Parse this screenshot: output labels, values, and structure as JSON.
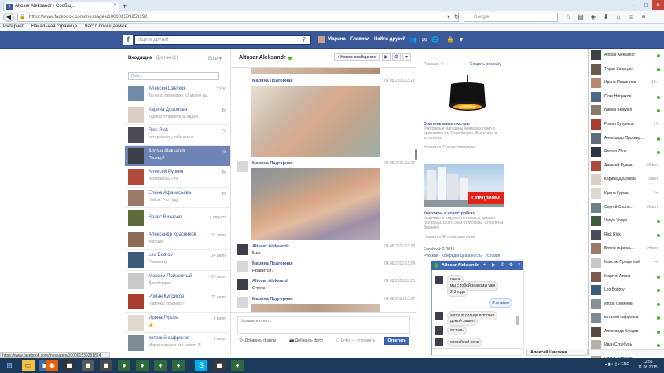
{
  "browser": {
    "tab_title": "Altosar Aleksandr - Сообщ...",
    "tab_close": "×",
    "new_tab": "+",
    "url": "https://www.facebook.com/messages/100001539259192",
    "search_placeholder": "Google",
    "bookmarks": [
      "Интернет",
      "Начальная страница",
      "Часто посещаемые"
    ],
    "status_url": "https://www.facebook.com/messages/100001539291824"
  },
  "fb": {
    "logo": "f",
    "search_placeholder": "Ищите друзей",
    "profile_name": "Марина",
    "home": "Главная",
    "find_friends": "Найти друзей"
  },
  "inbox": {
    "tab_inbox": "Входящие",
    "tab_other": "Другое (1)",
    "more": "Еще ▾",
    "search_placeholder": "Поиск",
    "conversations": [
      {
        "name": "Алексей Цветков",
        "snippet": "Ты но хз перевозку (c) может вы...",
        "time": "12:30",
        "avatar": "#6f8ba8"
      },
      {
        "name": "Карина Доцонова",
        "snippet": "Карина отправил(-а) видео.",
        "time": "Вт",
        "avatar": "#d9cfc4"
      },
      {
        "name": "Rick Rick",
        "snippet": "интересная у тебя жизнь",
        "time": "Пт",
        "avatar": "#4a4d58"
      },
      {
        "name": "Altosar Aleksandr",
        "snippet": "Почему?",
        "time": "Чт",
        "avatar": "#3a3f4a"
      },
      {
        "name": "Алексей Ручкин",
        "snippet": "Вспомнишь 7-го",
        "time": "Вт",
        "avatar": "#b04a3a"
      },
      {
        "name": "Елена Афанасьева",
        "snippet": "Найси. 7-го буд)",
        "time": "Вт",
        "avatar": "#9a7b67"
      },
      {
        "name": "Велес Вихарев",
        "snippet": "",
        "time": "4 августа",
        "avatar": "#5d6b3a"
      },
      {
        "name": "Александр Красников",
        "snippet": "Хорошо",
        "time": "31 июля",
        "avatar": "#8c6b52"
      },
      {
        "name": "Leo Bodrov",
        "snippet": "Приветик)",
        "time": "24 июля",
        "avatar": "#3d5a7a"
      },
      {
        "name": "Максим Прицепный",
        "snippet": "Докой пора!",
        "time": "23 июля",
        "avatar": "#c8c8c8"
      },
      {
        "name": "Роман Куприков",
        "snippet": "Рамочка, спасибо!!!",
        "time": "23 июля",
        "avatar": "#a63c2e"
      },
      {
        "name": "Ирина Гурова",
        "snippet": "👍",
        "time": "9 июля",
        "avatar": "#e0d8ce"
      },
      {
        "name": "виталий сафронов",
        "snippet": "Марина привет что нового !!!",
        "time": "2 июля",
        "avatar": "#7d8a96"
      }
    ]
  },
  "thread": {
    "name": "Altosar Aleksandr",
    "new_message": "+ Новое сообщение",
    "messages": [
      {
        "name": "Марина Подгорная",
        "time": "04.08.2015 13:22",
        "text": ""
      },
      {
        "name": "Марина Подгорная",
        "time": "04.08.2015 13:22",
        "text": ""
      },
      {
        "name": "Altosar Aleksandr",
        "time": "04.08.2015 13:23",
        "text": "Мне"
      },
      {
        "name": "Марина Подгорная",
        "time": "04.08.2015 13:24",
        "text": "Нравится?"
      },
      {
        "name": "Altosar Aleksandr",
        "time": "04.08.2015 13:25",
        "text": "Очень"
      },
      {
        "name": "Марина Подгорная",
        "time": "04.08.2015 13:27",
        "text": ""
      }
    ],
    "composer_placeholder": "Напишите ответ...",
    "add_files": "Добавить файлы",
    "add_photo": "Добавить фото",
    "enter_hint": "Enter — отправить",
    "send": "Ответить"
  },
  "ads": {
    "header": "Реклама",
    "create": "Создать рекламу",
    "items": [
      {
        "title": "Оригинальные люстры",
        "text": "Роскошные магазины немецких ламп в оригинальном Regenbogen. Все стили в каталогах.",
        "likes": "Нравится 27 пользователям"
      },
      {
        "title": "Квартиры в новостройках",
        "text": "Квартиры с отделкой в готовых домах г. Люберцы. Всего 3 км от Москвы. Спецпены! Звоните!",
        "likes": "Нравится 48 пользователям"
      }
    ],
    "banner_text": "Спецпены",
    "footer": "Facebook © 2015",
    "footer_links": "Русский · Конфиденциальность · Условия"
  },
  "chat": {
    "name": "Altosar Aleksandr",
    "messages": [
      {
        "text": "очень",
        "dir": "in"
      },
      {
        "text": "мы с тобой знакомы уже",
        "dir": "in"
      },
      {
        "text": "2-3 года",
        "dir": "in"
      },
      {
        "text": "Я плакаю",
        "dir": "out"
      },
      {
        "text": "хорошо солнце я только",
        "dir": "in"
      },
      {
        "text": "домой зашел",
        "dir": "in"
      },
      {
        "text": "я спать",
        "dir": "in"
      },
      {
        "text": "спокойной ночи",
        "dir": "in"
      }
    ],
    "bottom_tab": "Алексей Цветков"
  },
  "sidebar": {
    "contacts": [
      {
        "name": "Altosar Aleksandr",
        "status": "",
        "online": true
      },
      {
        "name": "Тиран Хачатрян",
        "status": "",
        "online": true
      },
      {
        "name": "Ирина Пашинина",
        "status": "18ч",
        "online": false
      },
      {
        "name": "Олег Ниграков",
        "status": "",
        "online": true
      },
      {
        "name": "Nikolai Belevich",
        "status": "",
        "online": true
      },
      {
        "name": "Роман Куприков",
        "status": "1ч",
        "online": false
      },
      {
        "name": "Александр Просвир...",
        "status": "",
        "online": true
      },
      {
        "name": "Roman Zhuk",
        "status": "",
        "online": true
      },
      {
        "name": "Алексей Ручкин",
        "status": "58мин",
        "online": false
      },
      {
        "name": "Карина Доцонова",
        "status": "9мин",
        "online": false
      },
      {
        "name": "Ирина Гурова",
        "status": "1ч",
        "online": false
      },
      {
        "name": "Сергей Социн...",
        "status": "16мин",
        "online": false
      },
      {
        "name": "Vanya Vanya",
        "status": "",
        "online": true
      },
      {
        "name": "Rick Rick",
        "status": "",
        "online": true
      },
      {
        "name": "Елена Афанас...",
        "status": "14мин",
        "online": false
      },
      {
        "name": "Максим Прицепный",
        "status": "4ч",
        "online": false
      },
      {
        "name": "Мартин Атмиа",
        "status": "",
        "online": true
      },
      {
        "name": "Leo Bodrov",
        "status": "",
        "online": true
      },
      {
        "name": "Игорь Семенов",
        "status": "",
        "online": true
      },
      {
        "name": "виталий сафронов",
        "status": "",
        "online": true
      },
      {
        "name": "Александр Клецов",
        "status": "",
        "online": true
      },
      {
        "name": "Иван Стребуль",
        "status": "",
        "online": true
      },
      {
        "name": "Елена Диденко",
        "status": "",
        "online": true
      }
    ]
  },
  "taskbar": {
    "lang": "ENG",
    "time": "12:51",
    "date": "11.08.2015"
  },
  "colors": {
    "fb_blue": "#3b5998",
    "selected_row": "#6d84b4",
    "online_green": "#42b72a"
  }
}
